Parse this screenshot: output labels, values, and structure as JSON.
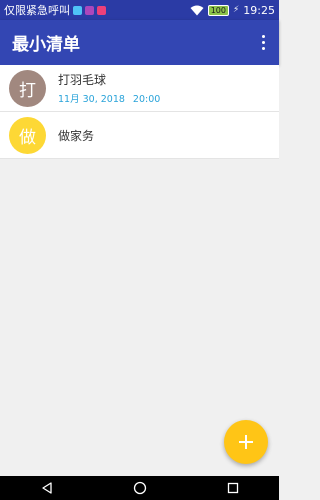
{
  "status_bar": {
    "carrier_text": "仅限紧急呼叫",
    "notification_icons": [
      {
        "name": "message-notification-icon",
        "color": "#4fc3f7"
      },
      {
        "name": "app-notification-icon",
        "color": "#ab47bc"
      },
      {
        "name": "camera-notification-icon",
        "color": "#ec407a"
      }
    ],
    "battery_level": "100",
    "time": "19:25"
  },
  "app_bar": {
    "title": "最小清单",
    "menu_icon": "more-vert-icon",
    "color": "#3346b3"
  },
  "todo_list": [
    {
      "avatar_char": "打",
      "avatar_color": "#a1887f",
      "title": "打羽毛球",
      "date": "11月 30, 2018",
      "time": "20:00"
    },
    {
      "avatar_char": "做",
      "avatar_color": "#fdd835",
      "title": "做家务"
    }
  ],
  "fab": {
    "icon": "add-icon",
    "color": "#ffc516"
  },
  "nav_bar": {
    "icons": [
      "back-icon",
      "home-icon",
      "recents-icon"
    ]
  }
}
